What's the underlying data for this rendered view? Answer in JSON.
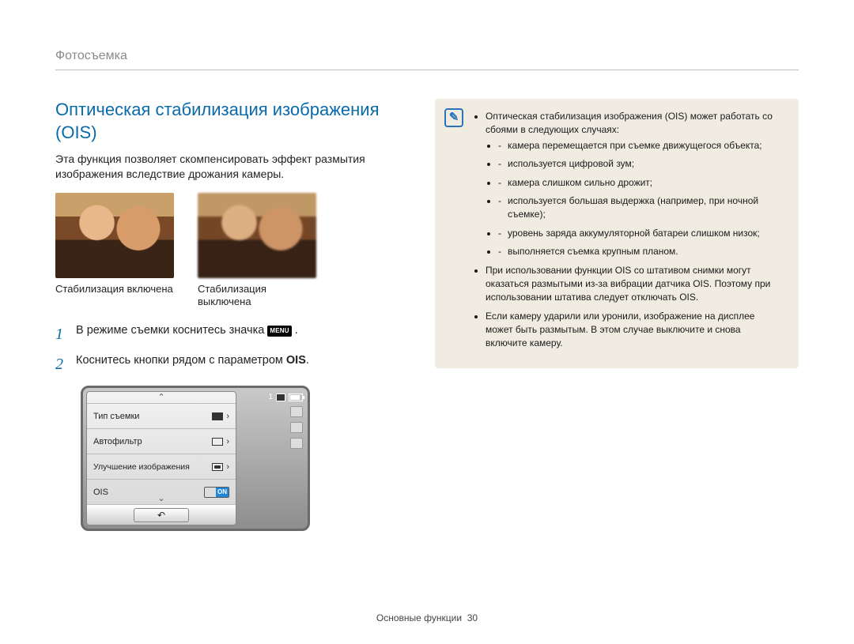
{
  "breadcrumb": "Фотосъемка",
  "heading": "Оптическая стабилизация изображения (OIS)",
  "lead": "Эта функция позволяет скомпенсировать эффект размытия изображения вследствие дрожания камеры.",
  "photos": {
    "on_caption": "Стабилизация включена",
    "off_caption": "Стабилизация выключена"
  },
  "steps": {
    "s1_pre": "В режиме съемки коснитесь значка ",
    "s1_chip": "MENU",
    "s1_post": " .",
    "s2_pre": "Коснитесь кнопки рядом с параметром ",
    "s2_bold": "OIS",
    "s2_post": "."
  },
  "camera_menu": {
    "counter": "1",
    "rows": [
      {
        "label": "Тип съемки"
      },
      {
        "label": "Автофильтр"
      },
      {
        "label": "Улучшение изображения"
      },
      {
        "label": "OIS",
        "toggle_on": "ON"
      }
    ]
  },
  "notes": {
    "b1_intro": "Оптическая стабилизация изображения (OIS) может работать со сбоями в следующих случаях:",
    "b1_items": [
      "камера перемещается при съемке движущегося объекта;",
      "используется цифровой зум;",
      "камера слишком сильно дрожит;",
      "используется большая выдержка (например, при ночной съемке);",
      "уровень заряда аккумуляторной батареи слишком низок;",
      "выполняется съемка крупным планом."
    ],
    "b2": "При использовании функции OIS со штативом снимки могут оказаться размытыми из-за вибрации датчика OIS. Поэтому при использовании штатива следует отключать OIS.",
    "b3": "Если камеру ударили или уронили, изображение на дисплее может быть размытым. В этом случае выключите и снова включите камеру."
  },
  "footer": {
    "section": "Основные функции",
    "page": "30"
  }
}
